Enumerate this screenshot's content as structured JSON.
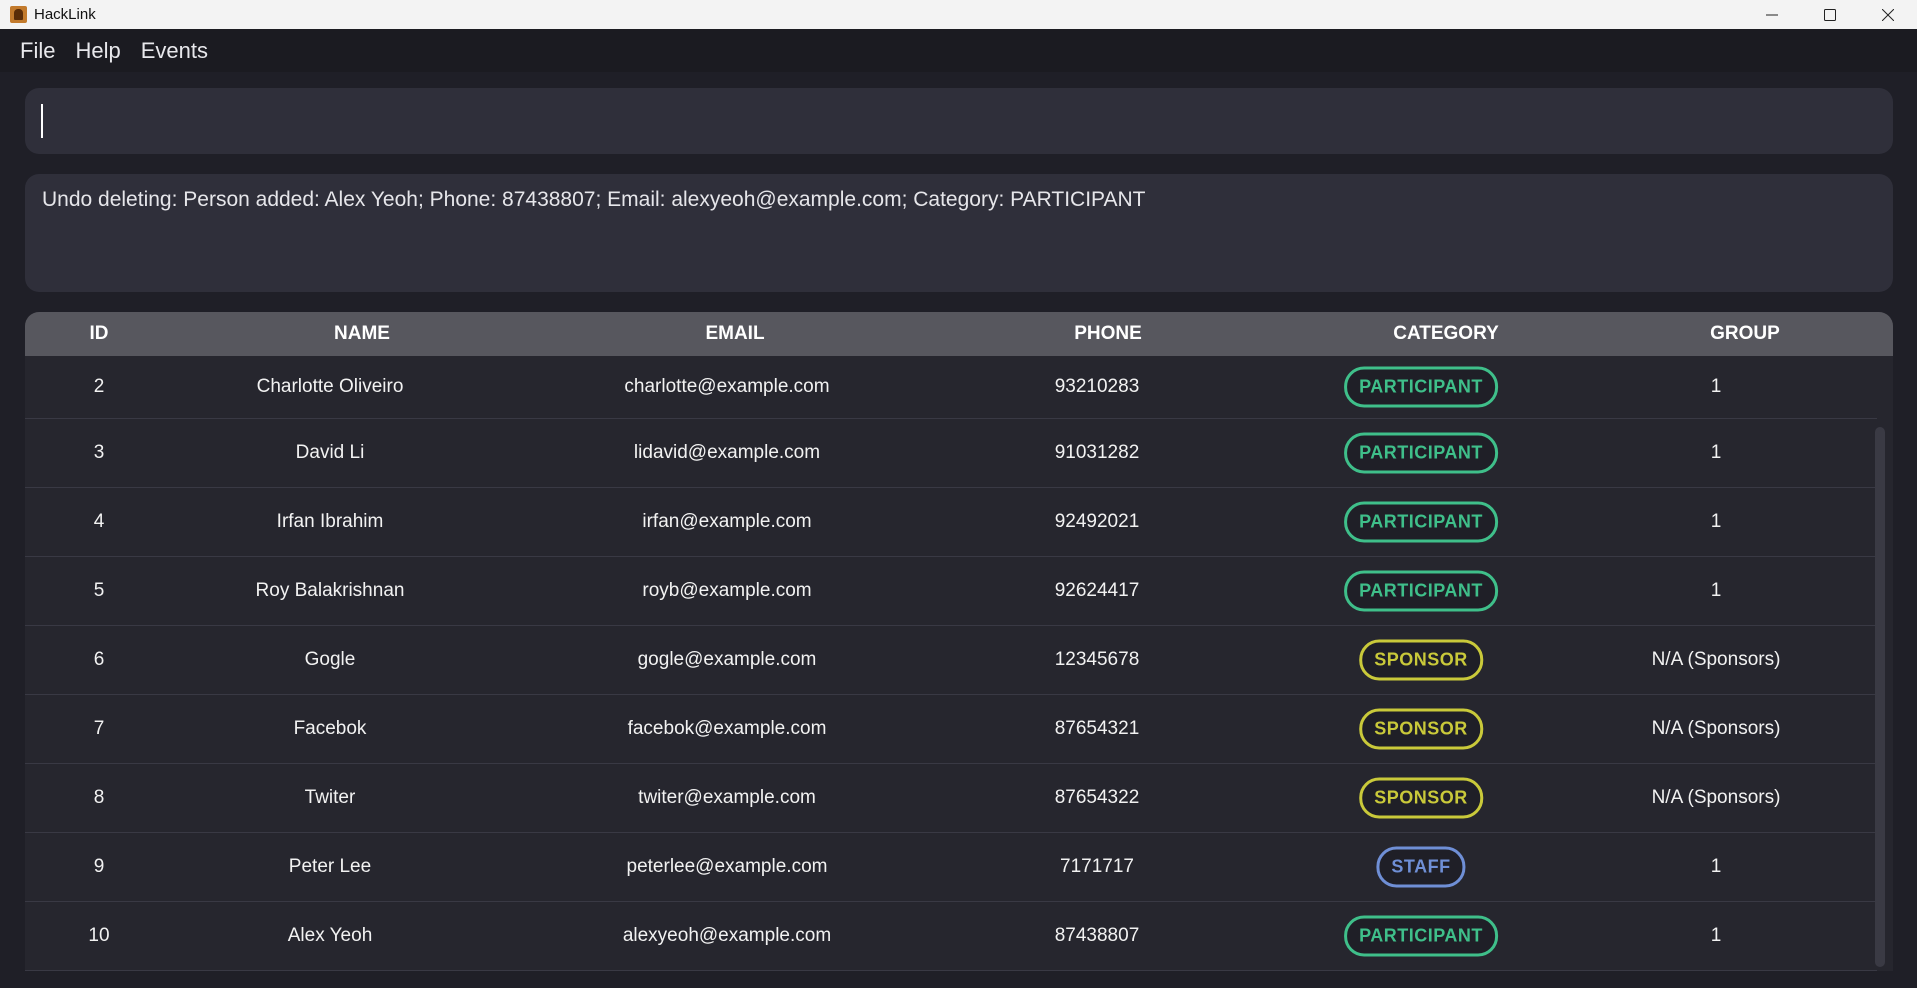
{
  "window": {
    "title": "HackLink",
    "controls": [
      "minimize-icon",
      "maximize-icon",
      "close-icon"
    ]
  },
  "menu": {
    "items": [
      "File",
      "Help",
      "Events"
    ]
  },
  "command": {
    "value": "",
    "placeholder": ""
  },
  "result": {
    "text": "Undo deleting: Person added: Alex Yeoh; Phone: 87438807; Email: alexyeoh@example.com; Category: PARTICIPANT"
  },
  "table": {
    "headers": {
      "id": "ID",
      "name": "NAME",
      "email": "EMAIL",
      "phone": "PHONE",
      "category": "CATEGORY",
      "group": "GROUP"
    },
    "rows": [
      {
        "id": "2",
        "name": "Charlotte Oliveiro",
        "email": "charlotte@example.com",
        "phone": "93210283",
        "category": "PARTICIPANT",
        "group": "1"
      },
      {
        "id": "3",
        "name": "David Li",
        "email": "lidavid@example.com",
        "phone": "91031282",
        "category": "PARTICIPANT",
        "group": "1"
      },
      {
        "id": "4",
        "name": "Irfan Ibrahim",
        "email": "irfan@example.com",
        "phone": "92492021",
        "category": "PARTICIPANT",
        "group": "1"
      },
      {
        "id": "5",
        "name": "Roy Balakrishnan",
        "email": "royb@example.com",
        "phone": "92624417",
        "category": "PARTICIPANT",
        "group": "1"
      },
      {
        "id": "6",
        "name": "Gogle",
        "email": "gogle@example.com",
        "phone": "12345678",
        "category": "SPONSOR",
        "group": "N/A (Sponsors)"
      },
      {
        "id": "7",
        "name": "Facebok",
        "email": "facebok@example.com",
        "phone": "87654321",
        "category": "SPONSOR",
        "group": "N/A (Sponsors)"
      },
      {
        "id": "8",
        "name": "Twiter",
        "email": "twiter@example.com",
        "phone": "87654322",
        "category": "SPONSOR",
        "group": "N/A (Sponsors)"
      },
      {
        "id": "9",
        "name": "Peter Lee",
        "email": "peterlee@example.com",
        "phone": "7171717",
        "category": "STAFF",
        "group": "1"
      },
      {
        "id": "10",
        "name": "Alex Yeoh",
        "email": "alexyeoh@example.com",
        "phone": "87438807",
        "category": "PARTICIPANT",
        "group": "1"
      }
    ]
  },
  "colors": {
    "background": "#1f1f27",
    "panel": "#2f2f3a",
    "header": "#57575e",
    "participant": "#3fbf8a",
    "sponsor": "#c9c93a",
    "staff": "#6f8fd6"
  }
}
